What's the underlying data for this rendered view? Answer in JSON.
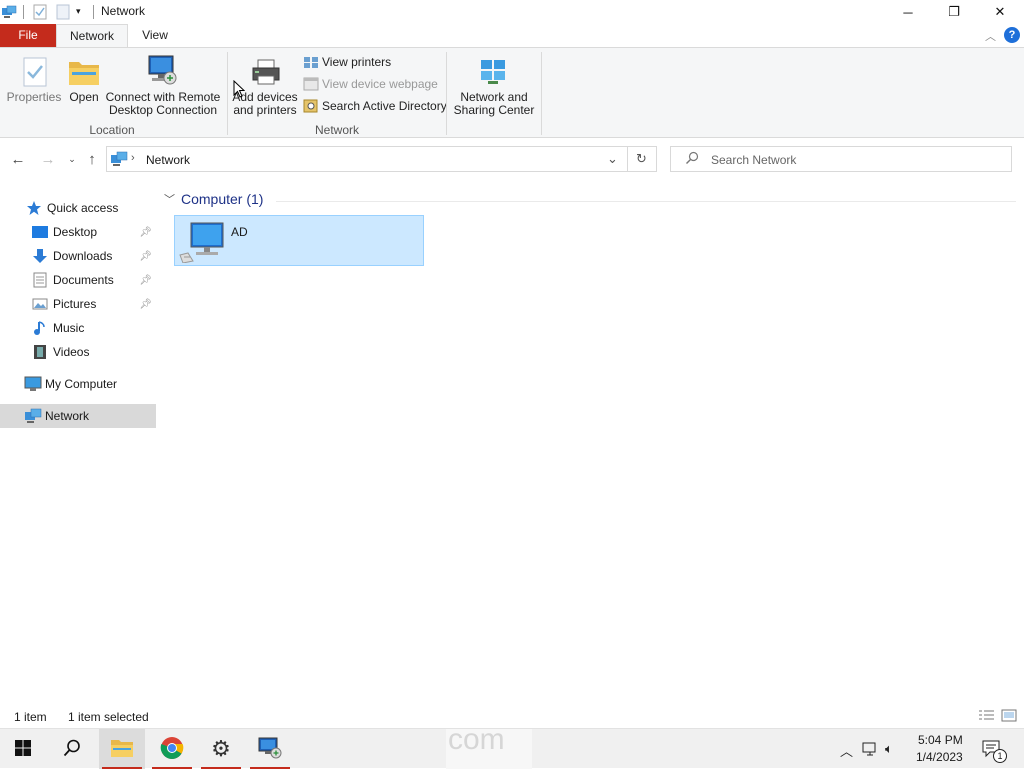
{
  "window": {
    "title": "Network",
    "controls": {
      "minimize": "─",
      "restore": "❐",
      "close": "✕"
    }
  },
  "ribbon_tabs": {
    "file": "File",
    "network": "Network",
    "view": "View"
  },
  "ribbon": {
    "properties": "Properties",
    "open": "Open",
    "remote_line1": "Connect with Remote",
    "remote_line2": "Desktop Connection",
    "group_location": "Location",
    "add_line1": "Add devices",
    "add_line2": "and printers",
    "view_printers": "View printers",
    "view_webpage": "View device webpage",
    "search_ad": "Search Active Directory",
    "group_network": "Network",
    "nsc_line1": "Network and",
    "nsc_line2": "Sharing Center"
  },
  "address": {
    "path": "Network",
    "search_placeholder": "Search Network"
  },
  "nav": {
    "quick_access": "Quick access",
    "desktop": "Desktop",
    "downloads": "Downloads",
    "documents": "Documents",
    "pictures": "Pictures",
    "music": "Music",
    "videos": "Videos",
    "my_computer": "My Computer",
    "network": "Network"
  },
  "content": {
    "group_title": "Computer (1)",
    "items": [
      {
        "name": "AD"
      }
    ]
  },
  "status": {
    "count": "1 item",
    "selected": "1 item selected"
  },
  "taskbar": {
    "watermark": "com",
    "time": "5:04 PM",
    "date": "1/4/2023",
    "notification_count": "1"
  },
  "colors": {
    "file_tab": "#c42b1c",
    "selection": "#cce8ff",
    "selection_border": "#99d1ff",
    "group_header": "#1e3287",
    "nav_selected": "#d9d9d9"
  },
  "icons": [
    "network-icon",
    "properties-icon",
    "folder-icon",
    "remote-desktop-icon",
    "printer-icon",
    "webpage-icon",
    "search-directory-icon",
    "network-sharing-icon",
    "back-arrow-icon",
    "forward-arrow-icon",
    "up-arrow-icon",
    "refresh-icon",
    "search-icon",
    "star-icon",
    "desktop-icon",
    "download-icon",
    "document-icon",
    "pictures-icon",
    "music-icon",
    "videos-icon",
    "computer-icon",
    "windows-start-icon",
    "chrome-icon",
    "gear-icon"
  ]
}
